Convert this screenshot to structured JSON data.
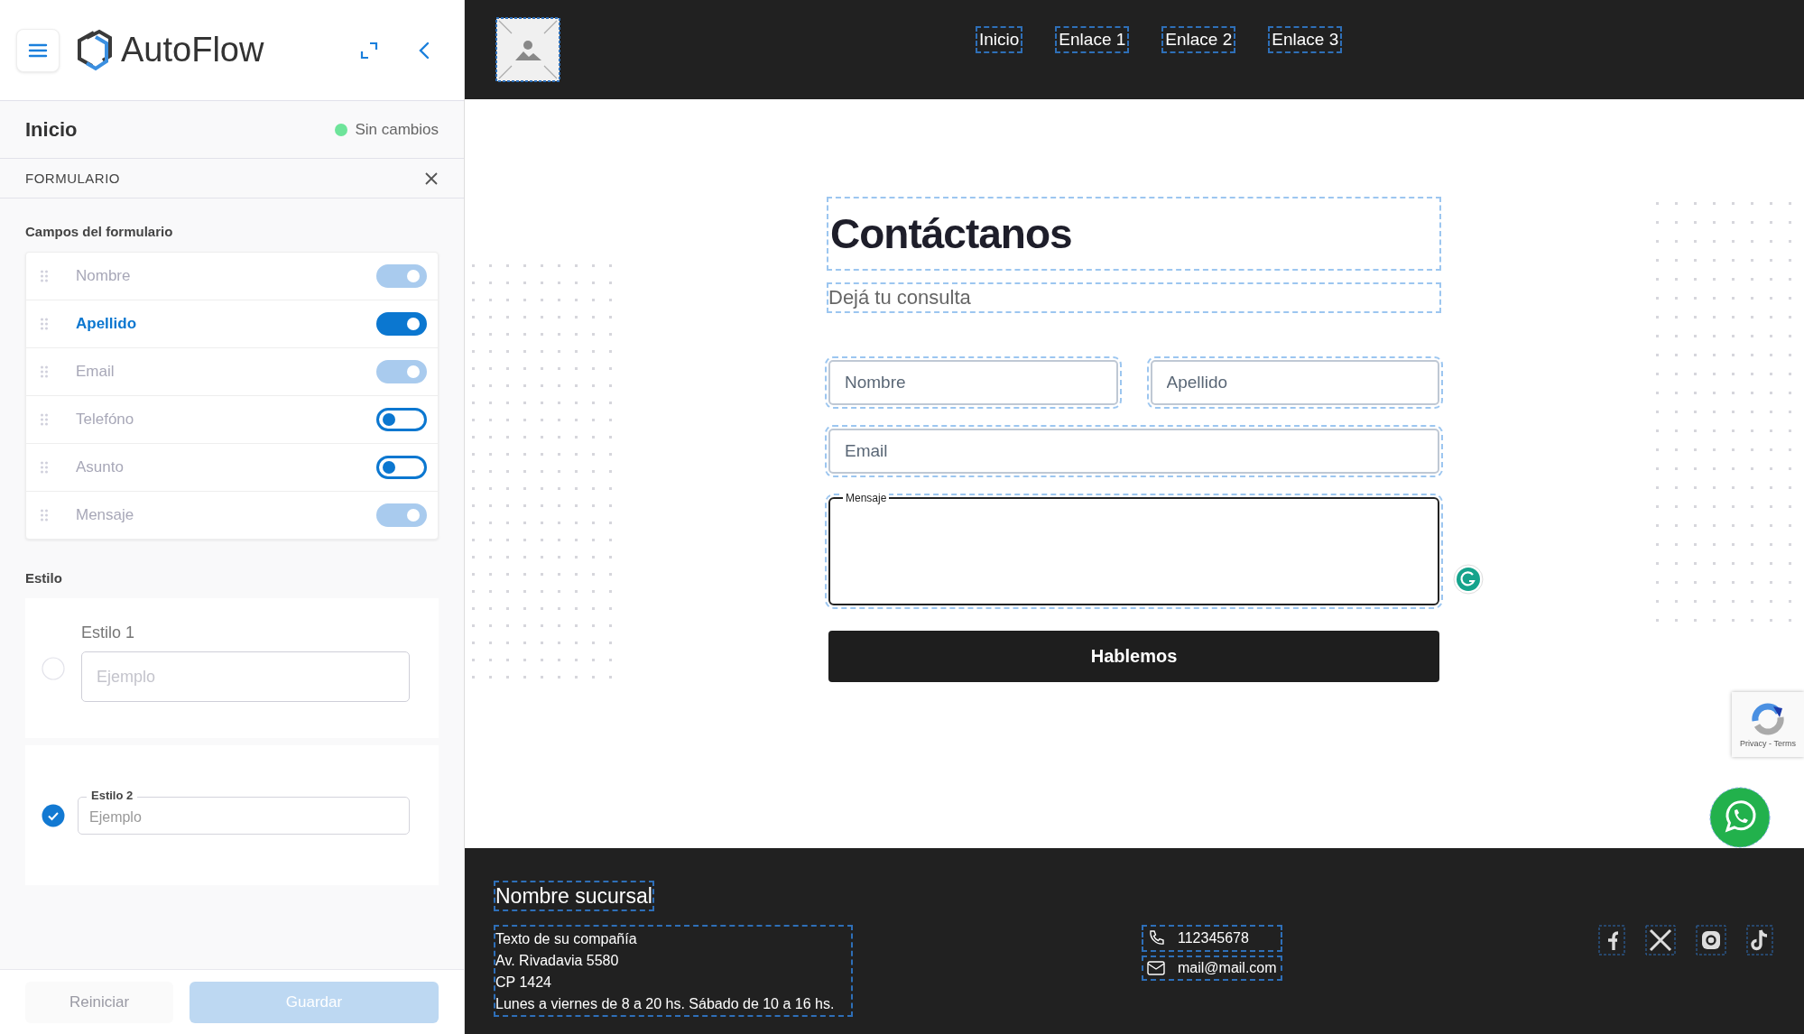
{
  "sidebar": {
    "brand": "AutoFlow",
    "page_title": "Inicio",
    "status": {
      "label": "Sin cambios",
      "color": "#6ee49a"
    },
    "section": "FORMULARIO",
    "fields_heading": "Campos del formulario",
    "fields": [
      {
        "label": "Nombre",
        "on": true,
        "disabled": true,
        "selected": false
      },
      {
        "label": "Apellido",
        "on": true,
        "disabled": false,
        "selected": true
      },
      {
        "label": "Email",
        "on": true,
        "disabled": true,
        "selected": false
      },
      {
        "label": "Telefóno",
        "on": false,
        "disabled": false,
        "selected": false
      },
      {
        "label": "Asunto",
        "on": false,
        "disabled": false,
        "selected": false
      },
      {
        "label": "Mensaje",
        "on": true,
        "disabled": true,
        "selected": false
      }
    ],
    "style_heading": "Estilo",
    "styles": [
      {
        "kind": "label-above",
        "label": "Estilo 1",
        "placeholder": "Ejemplo",
        "selected": false
      },
      {
        "kind": "floating-label",
        "label": "Estilo 2",
        "placeholder": "Ejemplo",
        "selected": true
      }
    ],
    "buttons": [
      {
        "label": "Reiniciar",
        "kind": "secondary",
        "disabled": true
      },
      {
        "label": "Guardar",
        "kind": "primary",
        "disabled": true
      }
    ]
  },
  "preview": {
    "nav": [
      "Inicio",
      "Enlace 1",
      "Enlace 2",
      "Enlace 3"
    ],
    "contact": {
      "title": "Contáctanos",
      "subtitle": "Dejá tu consulta",
      "fields": [
        {
          "kind": "input",
          "placeholder": "Nombre"
        },
        {
          "kind": "input",
          "placeholder": "Apellido"
        },
        {
          "kind": "input",
          "placeholder": "Email"
        },
        {
          "kind": "textarea",
          "label": "Mensaje"
        }
      ],
      "submit": "Hablemos"
    },
    "recaptcha": "Privacy - Terms",
    "footer": {
      "branch": "Nombre sucursal",
      "address": [
        "Texto de su compañía",
        "Av. Rivadavia 5580",
        "CP 1424",
        "Lunes a viernes de 8 a 20 hs. Sábado de 10 a 16 hs."
      ],
      "contacts": [
        {
          "kind": "phone",
          "text": "112345678"
        },
        {
          "kind": "mail",
          "text": "mail@mail.com"
        }
      ],
      "socials": [
        {
          "kind": "facebook"
        },
        {
          "kind": "x"
        },
        {
          "kind": "instagram"
        },
        {
          "kind": "tiktok"
        }
      ]
    }
  }
}
